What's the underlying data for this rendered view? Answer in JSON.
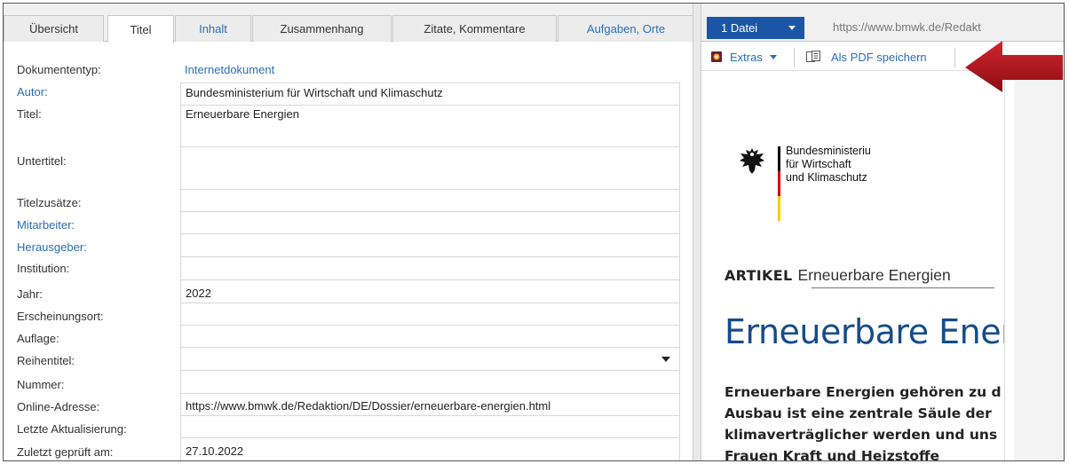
{
  "tabs": [
    {
      "label": "Übersicht",
      "active": false,
      "link": false
    },
    {
      "label": "Titel",
      "active": true,
      "link": false
    },
    {
      "label": "Inhalt",
      "active": false,
      "link": true
    },
    {
      "label": "Zusammenhang",
      "active": false,
      "link": false
    },
    {
      "label": "Zitate, Kommentare",
      "active": false,
      "link": false
    },
    {
      "label": "Aufgaben, Orte",
      "active": false,
      "link": true
    }
  ],
  "form": {
    "dokumententyp": {
      "label": "Dokumententyp:",
      "value": "Internetdokument"
    },
    "autor": {
      "label": "Autor:",
      "value": "Bundesministerium für Wirtschaft und Klimaschutz"
    },
    "titel": {
      "label": "Titel:",
      "value": "Erneuerbare Energien"
    },
    "untertitel": {
      "label": "Untertitel:",
      "value": ""
    },
    "titelzusaetze": {
      "label": "Titelzusätze:",
      "value": ""
    },
    "mitarbeiter": {
      "label": "Mitarbeiter:",
      "value": ""
    },
    "herausgeber": {
      "label": "Herausgeber:",
      "value": ""
    },
    "institution": {
      "label": "Institution:",
      "value": ""
    },
    "jahr": {
      "label": "Jahr:",
      "value": "2022"
    },
    "erscheinungsort": {
      "label": "Erscheinungsort:",
      "value": ""
    },
    "auflage": {
      "label": "Auflage:",
      "value": ""
    },
    "reihentitel": {
      "label": "Reihentitel:",
      "value": ""
    },
    "nummer": {
      "label": "Nummer:",
      "value": ""
    },
    "online_adresse": {
      "label": "Online-Adresse:",
      "value": "https://www.bmwk.de/Redaktion/DE/Dossier/erneuerbare-energien.html"
    },
    "letzte_aktualisierung": {
      "label": "Letzte Aktualisierung:",
      "value": ""
    },
    "zuletzt_geprueft": {
      "label": "Zuletzt geprüft am:",
      "value": "27.10.2022"
    }
  },
  "viewer": {
    "file_button": "1 Datei",
    "url": "https://www.bmwk.de/Redakt",
    "extras_label": "Extras",
    "save_pdf_label": "Als PDF speichern"
  },
  "document": {
    "ministry_lines": [
      "Bundesministeriu",
      "für Wirtschaft",
      "und Klimaschutz"
    ],
    "article_kicker": "ARTIKEL",
    "article_title": "Erneuerbare Energien",
    "headline": "Erneuerbare Ener",
    "body_lines": [
      "Erneuerbare Energien gehören zu d",
      "Ausbau ist eine zentrale Säule der",
      "klimaverträglicher werden und uns",
      "Frauen Kraft und Heizstoffe"
    ]
  },
  "colors": {
    "link": "#2a6ebb",
    "file_button": "#1a56a5",
    "headline": "#164c8a",
    "arrow": "#b5121b",
    "flag_black": "#000000",
    "flag_red": "#dd0000",
    "flag_gold": "#ffcc00"
  },
  "icons": {
    "extras": "extras-icon",
    "save_pdf": "pdf-save-icon",
    "dropdown": "chevron-down-icon",
    "eagle": "federal-eagle-icon",
    "arrow": "red-arrow-icon"
  }
}
